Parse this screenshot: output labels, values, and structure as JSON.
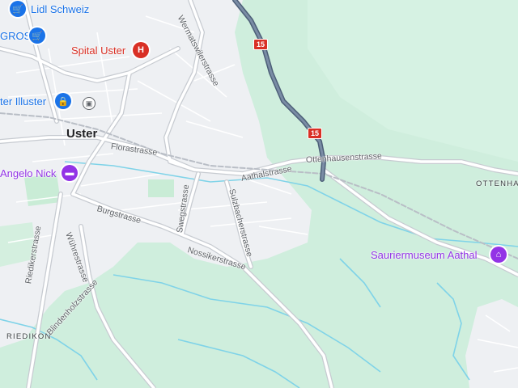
{
  "map": {
    "colors": {
      "green": "#cfeedd",
      "urban": "#eef0f3",
      "road": "#ffffff",
      "highway": "#64778f",
      "water": "#7fd3e8",
      "poi_red": "#d93025",
      "poi_blue": "#1a73e8",
      "poi_purple": "#9334e6"
    },
    "pois": [
      {
        "name": "Lidl Schweiz",
        "icon": "shopping-cart-icon",
        "color": "#1a73e8"
      },
      {
        "name": "GROS",
        "icon": "shopping-cart-icon",
        "color": "#1a73e8"
      },
      {
        "name": "Spital Uster",
        "icon": "hospital-icon",
        "color": "#d93025"
      },
      {
        "name": "ter Illuster",
        "icon": "shopping-bag-icon",
        "color": "#1a73e8"
      },
      {
        "name": "Angelo Nick",
        "icon": "chat-icon",
        "color": "#9334e6"
      },
      {
        "name": "Sauriermuseum Aathal",
        "icon": "museum-icon",
        "color": "#9334e6"
      }
    ],
    "places": {
      "town": "Uster",
      "riedikon": "RIEDIKON",
      "ottenhausen": "OTTENHA"
    },
    "streets": {
      "wermatswilerstrasse": "Wermatswilerstrasse",
      "florastrasse": "Florastrasse",
      "aathalstrasse": "Aathalstrasse",
      "ottenhausenstrasse": "Ottenhausenstrasse",
      "burgstrasse": "Burgstrasse",
      "sulzbacherstrasse": "Sulzbacherstrasse",
      "swegstrasse": "Swegstrasse",
      "nossikerstrasse": "Nossikerstrasse",
      "wuhrestrasse": "Wührestrasse",
      "riedikerstrasse": "Riedikerstrasse",
      "blindenholzstrasse": "Blindenholzstrasse"
    },
    "route_shields": [
      "15",
      "15"
    ],
    "rail_icon": "train-icon"
  }
}
